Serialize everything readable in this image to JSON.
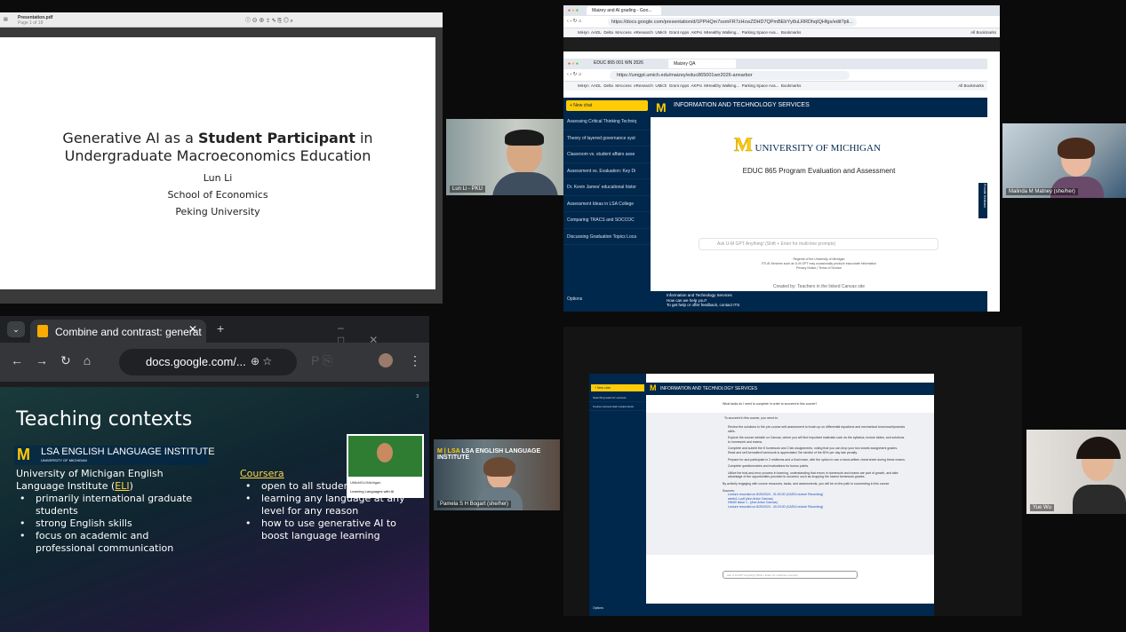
{
  "pdf": {
    "title": "Presentation.pdf",
    "pages": "Page 1 of 18"
  },
  "slide": {
    "line1a": "Generative AI as a",
    "line1b": "Student Participant",
    "line1c": "in",
    "line2": "Undergraduate Macroeconomics Education",
    "author": "Lun Li",
    "dept": "School of Economics",
    "univ": "Peking University"
  },
  "participants": {
    "p1": "Lun Li - PKU",
    "p2": "Malinda M Matney (she/her)",
    "p3": "Pamela S H Bogart (she/her)",
    "p4": "Yue Wu"
  },
  "chrome1": {
    "tab": "Maizey and AI grading - Goo...",
    "url": "https://docs.google.com/presentation/d/1PPHQm7ssmFR7zHcwZDHD7QPmBEbYy8uLRRDhqIQHfgs/edit?pli...",
    "bookmarks": [
      "MiHyn",
      "AADL",
      "Delta",
      "MAccess",
      "eResearch",
      "UMich",
      "Grant Apps",
      "AKPsi",
      "MHealthy Walking...",
      "Parking Space Ava...",
      "Bookmarks"
    ],
    "all_bookmarks": "All Bookmarks"
  },
  "chrome2": {
    "tab1": "EDUC 865 001 WN 2026",
    "tab2": "Maizey QA",
    "url": "https://umgpt.umich.edu/maizey/educ865001wn2026-annarbor",
    "new_chat": "+ New chat",
    "header": "INFORMATION AND TECHNOLOGY SERVICES",
    "history": [
      "Assessing Critical Thinking Techniq",
      "Theory of layered governance syst",
      "Classroom vs. student affairs asse",
      "Assessment vs. Evaluation: Key Di",
      "Dr. Kevin James' educational histor",
      "Assessment Ideas in LSA College",
      "Comparing TRACS and SOCCOC",
      "Discussing Graduation Topics Loca"
    ],
    "logo": "UNIVERSITY OF MICHIGAN",
    "course": "EDUC 865 Program Evaluation and Assessment",
    "input": "Ask U-M GPT Anything! (Shift + Enter for multi-line prompts)",
    "footer1": "Regents of the University of Michigan",
    "footer2": "ITS AI Services such as U-M GPT may occasionally produce inaccurate information",
    "footer3": "Privacy Notice | Terms of Service",
    "created": "Created by: Teachers in the linked Canvas site",
    "options": "Options",
    "help1": "Information and Technology Services",
    "help2": "How can we help you?",
    "help3": "To get help or offer feedback, contact ITS",
    "feedback": "Provide feedback"
  },
  "gdocs": {
    "tab": "Combine and contrast: generat",
    "url": "docs.google.com/...",
    "slide_title": "Teaching contexts",
    "eli_logo": "LSA ENGLISH LANGUAGE INSTITUTE",
    "eli_sub": "UNIVERSITY OF MICHIGAN",
    "left_head1": "University of Michigan English",
    "left_head2a": "Language Institute (",
    "left_head2b": "ELI",
    "left_head2c": ")",
    "left": [
      "primarily international graduate students",
      "strong English skills",
      "focus on academic and professional communication"
    ],
    "right_head": "Coursera",
    "right": [
      "open to all students globally",
      "learning any language at any level for any reason",
      "how to use generative AI to boost language learning"
    ],
    "thumb": "Learning Languages with AI",
    "thumb_org": "UMichELI/Michigan",
    "page": "3"
  },
  "maizey2": {
    "header": "INFORMATION AND TECHNOLOGY SERVICES",
    "new_chat": "+ New chat",
    "items": [
      "Searching tasks for success",
      "Course success task requirements"
    ],
    "question": "What tasks do I need to complete in order to succeed in this course?",
    "answer_intro": "To succeed in this course, you need to:",
    "bullets": [
      "Review the solutions to the pre-course self-assessment to brush up on differential equations and mechanical tomorrow/dynamics skills.",
      "Explore the course website on Canvas, where you will find important materials such as the syllabus, lecture slides, and solutions to homework and exams.",
      "Complete and submit the 8 homework and 2 lab assignments, noting that you can drop your two lowest assignment grades. Read and self-formatted homework is appreciated. Be mindful of the 50% per day late penalty.",
      "Prepare for and participate in 2 midterms and a final exam, with the option to use a hand-written cheat sheet during these exams.",
      "Complete questionnaires and evaluations for bonus points.",
      "Utilize the trial-and-error process in learning, understanding that errors in homework and exams are part of growth, and take advantage of the opportunities provided to succeed, such as dropping the lowest homework grades."
    ],
    "closing": "By actively engaging with course resources, tasks, and assessments, you will be on the path to succeeding in this course.",
    "sources_label": "Sources:",
    "sources": [
      "Lecture recorded on 8/29/2024 - 01:00:00 (CAEN Lecture Recording)",
      "week4-1.pdf (Ann Arbor Canvas)",
      "HW#0 Issue 1 - (Ann Arbor Canvas)",
      "Lecture recorded on 8/29/2024 - 00:23:00 (CAEN Lecture Recording)"
    ],
    "input": "Ask U-M GPT Anything! (Shift + Enter for multi-line prompts)",
    "options": "Options"
  },
  "colors": {
    "umblue": "#00274c",
    "maize": "#ffcb05"
  }
}
